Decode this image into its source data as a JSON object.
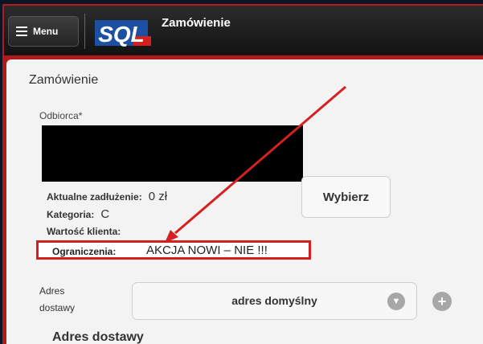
{
  "header": {
    "menu_label": "Menu",
    "title": "Zamówienie",
    "logo_text": "SQL"
  },
  "main": {
    "page_title": "Zamówienie",
    "recipient_label": "Odbiorca*",
    "debt_label": "Aktualne zadłużenie:",
    "debt_value": "0 zł",
    "category_label": "Kategoria:",
    "category_value": "C",
    "client_value_label": "Wartość klienta:",
    "restrictions_label": "Ograniczenia:",
    "restrictions_value": "AKCJA NOWI – NIE !!!",
    "choose_button": "Wybierz",
    "address_label_line1": "Adres",
    "address_label_line2": "dostawy",
    "address_select_value": "adres domyślny",
    "section_title": "Adres dostawy"
  },
  "colors": {
    "highlight": "#d42020",
    "frame": "#b11a1a",
    "topbar": "#1a1a1a"
  }
}
